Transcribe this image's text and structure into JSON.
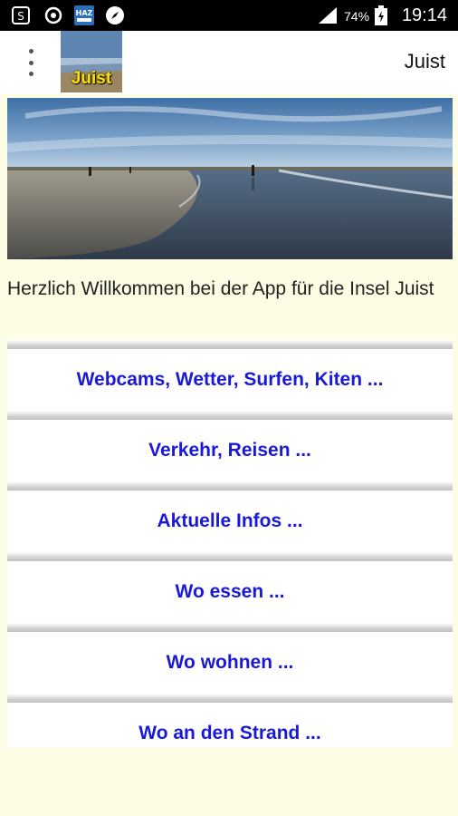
{
  "status_bar": {
    "battery_percent": "74%",
    "time": "19:14",
    "icons": [
      "screenshot-icon",
      "sync-icon",
      "haz-epaper-app-icon",
      "compass-icon",
      "signal-icon",
      "battery-icon"
    ]
  },
  "action_bar": {
    "logo_text": "Juist",
    "title": "Juist"
  },
  "welcome_text": "Herzlich Willkommen bei der App für die Insel Juist",
  "menu_buttons": [
    "Webcams, Wetter, Surfen, Kiten ...",
    "Verkehr, Reisen ...",
    "Aktuelle Infos ...",
    "Wo essen ...",
    "Wo wohnen ...",
    "Wo an den Strand ..."
  ],
  "colors": {
    "background": "#fdfde6",
    "button_text": "#1a1ad6",
    "logo_text": "#ffe300"
  }
}
